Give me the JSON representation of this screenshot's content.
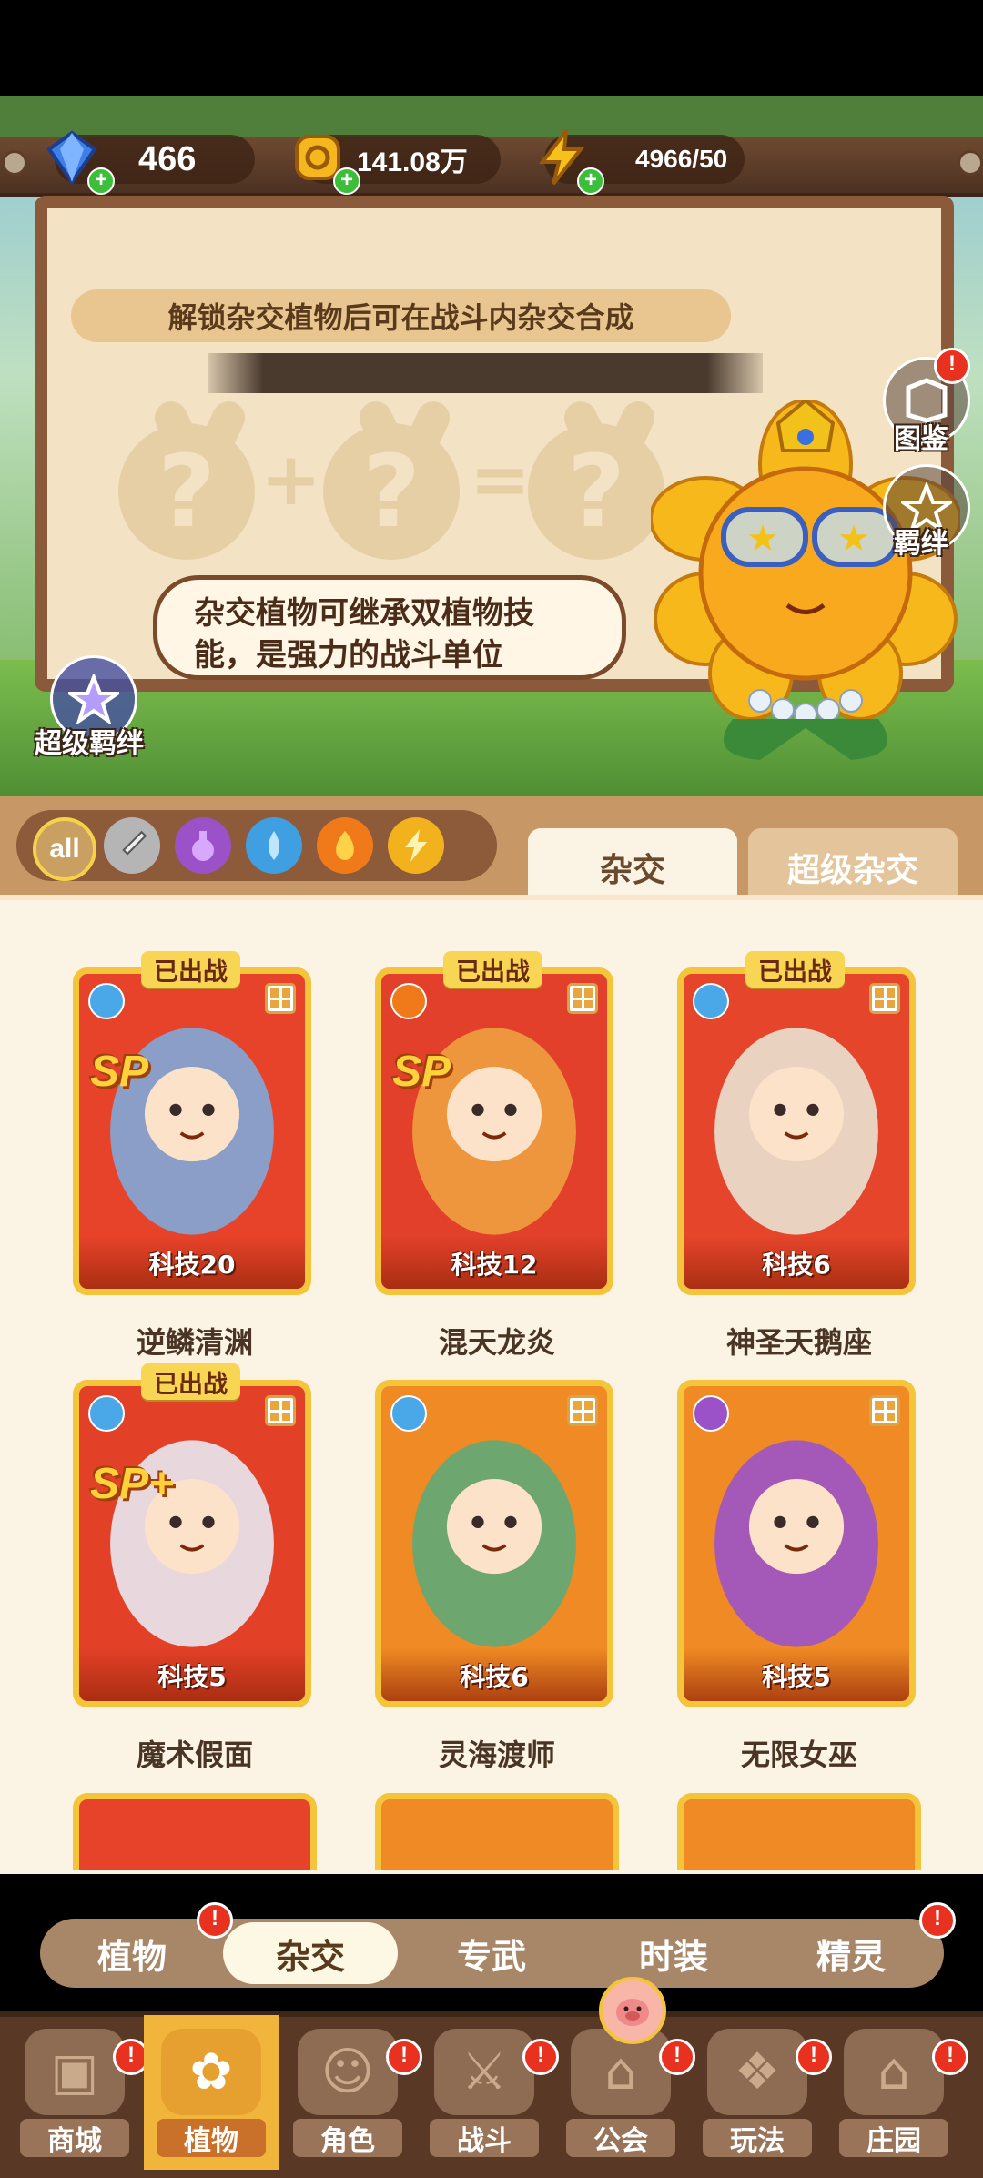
{
  "currency": {
    "diamonds": "466",
    "coins": "141.08万",
    "energy": "4966/50"
  },
  "hybrid_panel": {
    "unlock_text": "解锁杂交植物后可在战斗内杂交合成",
    "speech_text": "杂交植物可继承双植物技能，是强力的战斗单位"
  },
  "side_buttons": {
    "codex": "图鉴",
    "bond": "羁绊",
    "super_bond": "超级羁绊"
  },
  "filters": {
    "all_label": "all"
  },
  "tabs": {
    "hybrid": "杂交",
    "super_hybrid": "超级杂交"
  },
  "cards": [
    {
      "name": "逆鳞清渊",
      "level": "科技20",
      "deployed": "已出战",
      "badge": "SP",
      "color_top": "#7fa8d8",
      "color_bg": "#e7432a"
    },
    {
      "name": "混天龙炎",
      "level": "科技12",
      "deployed": "已出战",
      "badge": "SP",
      "color_top": "#f0a040",
      "color_bg": "#e2402a"
    },
    {
      "name": "神圣天鹅座",
      "level": "科技6",
      "deployed": "已出战",
      "badge": "",
      "color_top": "#e9e2d0",
      "color_bg": "#e5452b"
    },
    {
      "name": "魔术假面",
      "level": "科技5",
      "deployed": "已出战",
      "badge": "SP+",
      "color_top": "#e8e8f0",
      "color_bg": "#e34028"
    },
    {
      "name": "灵海渡师",
      "level": "科技6",
      "deployed": "",
      "badge": "",
      "color_top": "#5fa878",
      "color_bg": "#ef8a24"
    },
    {
      "name": "无限女巫",
      "level": "科技5",
      "deployed": "",
      "badge": "",
      "color_top": "#9b52c8",
      "color_bg": "#ef8a24"
    }
  ],
  "sub_tabs": [
    "植物",
    "杂交",
    "专武",
    "时装",
    "精灵"
  ],
  "bottom_nav": [
    "商城",
    "植物",
    "角色",
    "战斗",
    "公会",
    "玩法",
    "庄园"
  ],
  "badge_mark": "!"
}
